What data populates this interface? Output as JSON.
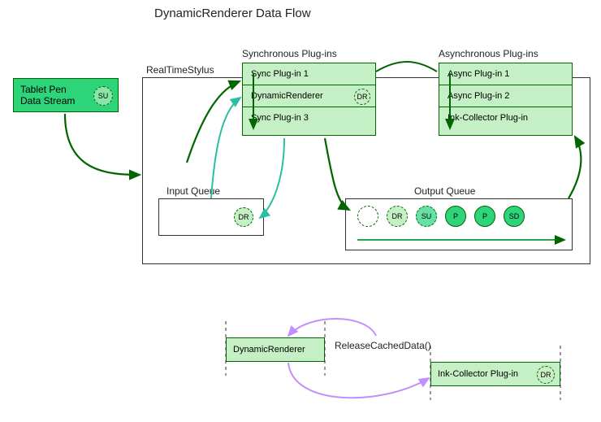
{
  "title": "DynamicRenderer Data Flow",
  "tablet_pen": {
    "line1": "Tablet Pen",
    "line2": "Data Stream",
    "badge": "SU"
  },
  "rts_label": "RealTimeStylus",
  "sync": {
    "header": "Synchronous Plug-ins",
    "items": [
      "Sync Plug-in 1",
      "DynamicRenderer",
      "Sync Plug-in 3"
    ],
    "dr_badge": "DR"
  },
  "async": {
    "header": "Asynchronous Plug-ins",
    "items": [
      "Async Plug-in 1",
      "Async Plug-in 2",
      "Ink-Collector Plug-in"
    ]
  },
  "input_queue": {
    "header": "Input Queue",
    "badge": "DR"
  },
  "output_queue": {
    "header": "Output Queue",
    "badges": [
      "",
      "DR",
      "SU",
      "P",
      "P",
      "SD"
    ]
  },
  "bottom": {
    "dyn_renderer": "DynamicRenderer",
    "release_call": "ReleaseCachedData()",
    "ink_collector": "Ink-Collector Plug-in",
    "ink_badge": "DR"
  },
  "colors": {
    "green_dark": "#006600",
    "green_fill_light": "#c5f0c5",
    "green_fill_mid": "#66e0a3",
    "green_fill_bright": "#2ed47a",
    "teal": "#2bbfa0",
    "purple": "#c38fff"
  }
}
